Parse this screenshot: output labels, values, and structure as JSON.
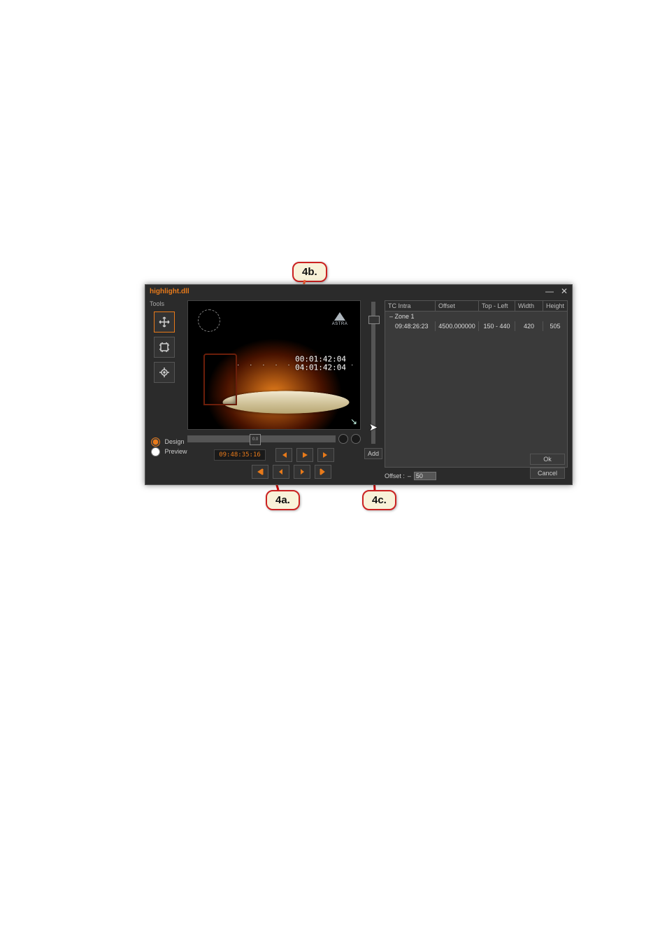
{
  "dialog": {
    "title": "highlight.dll",
    "window": {
      "minimize": "—",
      "close": "✕"
    },
    "tools": {
      "label": "Tools"
    },
    "mode": {
      "design_label": "Design",
      "preview_label": "Preview",
      "selected": "design"
    },
    "preview": {
      "logo_text": "ASTRA",
      "tc_overlay_1": "00:01:42:04",
      "tc_overlay_2": "04:01:42:04",
      "selection_arrow": "↘"
    },
    "scrubber": {
      "knob_label": "0.0"
    },
    "transport": {
      "timecode": "09:48:35:16"
    },
    "add_button": "Add",
    "grid": {
      "headers": {
        "tc": "TC Intra",
        "offset": "Offset",
        "topleft": "Top - Left",
        "width": "Width",
        "height": "Height"
      },
      "zone_label": "– Zone 1",
      "rows": [
        {
          "tc": "09:48:26:23",
          "offset": "4500.000000",
          "topleft": "150 - 440",
          "width": "420",
          "height": "505"
        }
      ]
    },
    "offset_field": {
      "label": "Offset :",
      "sign": "–",
      "value": "50"
    },
    "buttons": {
      "ok": "Ok",
      "cancel": "Cancel"
    }
  },
  "callouts": {
    "b4b": "4b.",
    "b4a": "4a.",
    "b4c": "4c."
  }
}
